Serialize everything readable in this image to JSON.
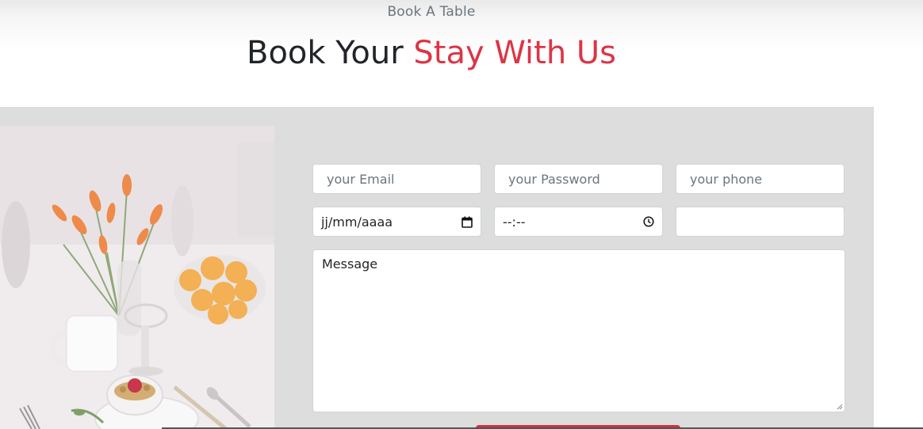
{
  "header": {
    "eyebrow": "Book A Table",
    "title_main": "Book Your ",
    "title_accent": "Stay With Us"
  },
  "form": {
    "email_placeholder": "your Email",
    "password_placeholder": "your Password",
    "phone_placeholder": "your phone",
    "date_value": "jj/mm/aaaa",
    "time_value": "--:--",
    "extra_value": "",
    "message_placeholder": "Message"
  },
  "icons": {
    "date": "calendar-icon",
    "time": "clock-icon"
  },
  "colors": {
    "accent": "#dc3545",
    "panel_background": "#dddddd",
    "heading": "#212529"
  }
}
